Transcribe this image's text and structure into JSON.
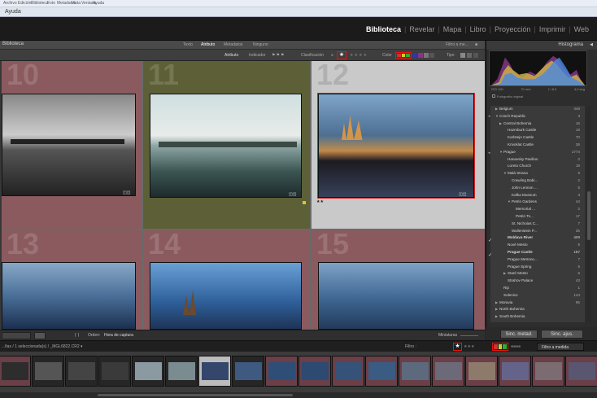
{
  "menubar": {
    "items": [
      "Archivo",
      "Edición",
      "Biblioteca",
      "Foto",
      "Metadatos",
      "Vista",
      "Ventana",
      "Ayuda"
    ]
  },
  "help_menu": "Ayuda",
  "modules": [
    "Biblioteca",
    "Revelar",
    "Mapa",
    "Libro",
    "Proyección",
    "Imprimir",
    "Web"
  ],
  "active_module": "Biblioteca",
  "panel_title": "Biblioteca",
  "filter_tabs": [
    "Texto",
    "Atributo",
    "Metadatos",
    "Ninguno"
  ],
  "active_filter_tab": "Atributo",
  "filter_preset": "Filtro a me...",
  "attribute_bar": {
    "label": "Atributo",
    "flag_label": "Indicador",
    "rating_label": "Clasificación",
    "rating_operator": "≥",
    "color_label": "Color",
    "type_label": "Tipo"
  },
  "grid_cells": [
    {
      "number": "10",
      "label_color": "#8a5a5f"
    },
    {
      "number": "11",
      "label_color": "#5d5f36"
    },
    {
      "number": "12",
      "label_color": "#c9c9c9"
    },
    {
      "number": "13",
      "label_color": "#8a5a5f"
    },
    {
      "number": "14",
      "label_color": "#8a5a5f"
    },
    {
      "number": "15",
      "label_color": "#8a5a5f"
    }
  ],
  "grid_toolbar": {
    "sort_label": "Orden:",
    "sort_value": "Hora de captura",
    "thumb_label": "Miniaturas"
  },
  "histogram": {
    "title": "Histograma",
    "iso": "ISO 100",
    "focal": "70 mm",
    "aperture": "f / 8,0",
    "shutter": "4,0 seg",
    "original": "Fotografía original"
  },
  "keyword_tree": [
    {
      "name": "Belgium",
      "count": "446",
      "depth": 1,
      "twisty": "▶"
    },
    {
      "name": "Czech Republic",
      "count": "3",
      "depth": 1,
      "twisty": "▼"
    },
    {
      "name": "Central Bohemia",
      "count": "16",
      "depth": 2,
      "twisty": "▶"
    },
    {
      "name": "Hazmburk Castle",
      "count": "19",
      "depth": 3,
      "twisty": ""
    },
    {
      "name": "Karlstejn Castle",
      "count": "70",
      "depth": 3,
      "twisty": ""
    },
    {
      "name": "Krivoklat Castle",
      "count": "36",
      "depth": 3,
      "twisty": ""
    },
    {
      "name": "Prague",
      "count": "1774",
      "depth": 2,
      "twisty": "▼"
    },
    {
      "name": "Hanavsky Pavilion",
      "count": "2",
      "depth": 3,
      "twisty": ""
    },
    {
      "name": "Loreto Church",
      "count": "19",
      "depth": 3,
      "twisty": ""
    },
    {
      "name": "Malá Strana",
      "count": "6",
      "depth": 3,
      "twisty": "▼"
    },
    {
      "name": "Crawling Babi...",
      "count": "2",
      "depth": 4,
      "twisty": ""
    },
    {
      "name": "John Lennon ...",
      "count": "5",
      "depth": 4,
      "twisty": ""
    },
    {
      "name": "Kafka Museum",
      "count": "3",
      "depth": 4,
      "twisty": ""
    },
    {
      "name": "Petrin Gardens",
      "count": "44",
      "depth": 4,
      "twisty": "▼"
    },
    {
      "name": "Memorial ...",
      "count": "2",
      "depth": 5,
      "twisty": ""
    },
    {
      "name": "Petrin To...",
      "count": "17",
      "depth": 5,
      "twisty": ""
    },
    {
      "name": "St. Nicholas C...",
      "count": "7",
      "depth": 4,
      "twisty": ""
    },
    {
      "name": "Wallenstein P...",
      "count": "35",
      "depth": 4,
      "twisty": ""
    },
    {
      "name": "Moldava River",
      "count": "409",
      "depth": 3,
      "twisty": "",
      "check": true,
      "bold": true
    },
    {
      "name": "Nové Mesto",
      "count": "5",
      "depth": 3,
      "twisty": ""
    },
    {
      "name": "Prague Castle",
      "count": "187",
      "depth": 3,
      "twisty": "",
      "check": true,
      "bold": true
    },
    {
      "name": "Prague Metrono...",
      "count": "7",
      "depth": 3,
      "twisty": ""
    },
    {
      "name": "Prague Spring",
      "count": "5",
      "depth": 3,
      "twisty": ""
    },
    {
      "name": "Staré Mesto",
      "count": "6",
      "depth": 3,
      "twisty": "▶"
    },
    {
      "name": "Strahov Palace",
      "count": "43",
      "depth": 3,
      "twisty": ""
    },
    {
      "name": "Rip",
      "count": "1",
      "depth": 2,
      "twisty": ""
    },
    {
      "name": "Solenice",
      "count": "144",
      "depth": 2,
      "twisty": ""
    },
    {
      "name": "Moravia",
      "count": "95",
      "depth": 1,
      "twisty": "▶"
    },
    {
      "name": "North Bohemia",
      "count": "",
      "depth": 1,
      "twisty": "▶"
    },
    {
      "name": "South Bohemia",
      "count": "",
      "depth": 1,
      "twisty": "▶"
    }
  ],
  "sync_buttons": [
    "Sinc. metad.",
    "Sinc. ajus."
  ],
  "filmstrip_bar": {
    "source": "...fias / 1 seleccionada(s) / _MGL6822.CR2 ▾",
    "filter_label": "Filtro :",
    "filter_preset": "Filtro a medida"
  },
  "filmstrip_frames": [
    {
      "tone": "pink",
      "img": "#2d2d2d"
    },
    {
      "tone": "dark",
      "img": "#555"
    },
    {
      "tone": "dark",
      "img": "#444"
    },
    {
      "tone": "dark",
      "img": "#3a3a3a"
    },
    {
      "tone": "dark",
      "img": "#8a9aa0"
    },
    {
      "tone": "dark",
      "img": "#7a8c8f"
    },
    {
      "tone": "sel",
      "img": "#34466b"
    },
    {
      "tone": "dark",
      "img": "#3e5a80"
    },
    {
      "tone": "pink",
      "img": "#2f4e77"
    },
    {
      "tone": "pink",
      "img": "#2c4a72"
    },
    {
      "tone": "pink",
      "img": "#355378"
    },
    {
      "tone": "pink",
      "img": "#3a5b82"
    },
    {
      "tone": "pink",
      "img": "#5d6a7d"
    },
    {
      "tone": "pink",
      "img": "#6c6a78"
    },
    {
      "tone": "pink",
      "img": "#8e7a6a"
    },
    {
      "tone": "pink",
      "img": "#64648a"
    },
    {
      "tone": "pink",
      "img": "#7a6c70"
    },
    {
      "tone": "pink",
      "img": "#5a5570"
    }
  ]
}
